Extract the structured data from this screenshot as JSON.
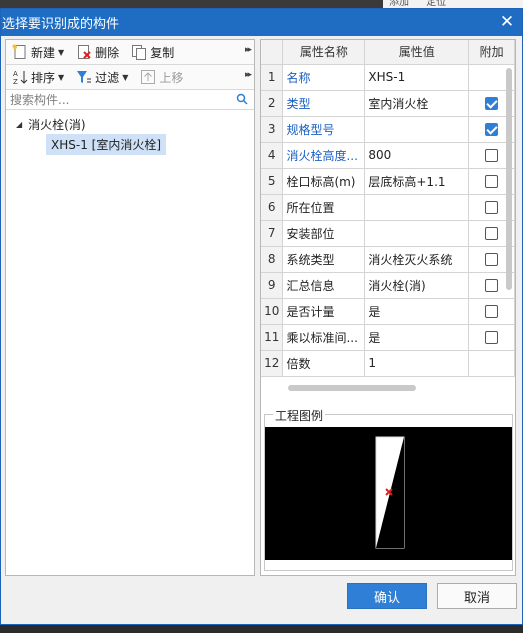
{
  "background": {
    "menu": [
      "添加",
      "定位"
    ]
  },
  "dialog": {
    "title": "选择要识别成的构件",
    "close": "✕"
  },
  "toolbar1": {
    "new": "新建",
    "delete": "删除",
    "copy": "复制",
    "more": "▸▸"
  },
  "toolbar2": {
    "sort": "排序",
    "filter": "过滤",
    "move_up": "上移",
    "more": "▸▸"
  },
  "search": {
    "placeholder": "搜索构件..."
  },
  "tree": {
    "root": "消火栓(消)",
    "child": "XHS-1 [室内消火栓]"
  },
  "grid": {
    "headers": [
      "",
      "属性名称",
      "属性值",
      "附加"
    ],
    "rows": [
      {
        "n": "1",
        "name": "名称",
        "value": "XHS-1",
        "blue": true,
        "check": null
      },
      {
        "n": "2",
        "name": "类型",
        "value": "室内消火栓",
        "blue": true,
        "check": true
      },
      {
        "n": "3",
        "name": "规格型号",
        "value": "",
        "blue": true,
        "check": true
      },
      {
        "n": "4",
        "name": "消火栓高度...",
        "value": "800",
        "blue": true,
        "check": false
      },
      {
        "n": "5",
        "name": "栓口标高(m)",
        "value": "层底标高+1.1",
        "blue": false,
        "check": false
      },
      {
        "n": "6",
        "name": "所在位置",
        "value": "",
        "blue": false,
        "check": false
      },
      {
        "n": "7",
        "name": "安装部位",
        "value": "",
        "blue": false,
        "check": false
      },
      {
        "n": "8",
        "name": "系统类型",
        "value": "消火栓灭火系统",
        "blue": false,
        "check": false
      },
      {
        "n": "9",
        "name": "汇总信息",
        "value": "消火栓(消)",
        "blue": false,
        "check": false
      },
      {
        "n": "10",
        "name": "是否计量",
        "value": "是",
        "blue": false,
        "check": false
      },
      {
        "n": "11",
        "name": "乘以标准间...",
        "value": "是",
        "blue": false,
        "check": false
      },
      {
        "n": "12",
        "name": "倍数",
        "value": "1",
        "blue": false,
        "check": null
      }
    ]
  },
  "legend": {
    "title": "工程图例"
  },
  "buttons": {
    "ok": "确认",
    "cancel": "取消"
  },
  "colors": {
    "accent": "#2f7fd6",
    "titlebar": "#1e6dc2",
    "link": "#1a5fc4"
  }
}
